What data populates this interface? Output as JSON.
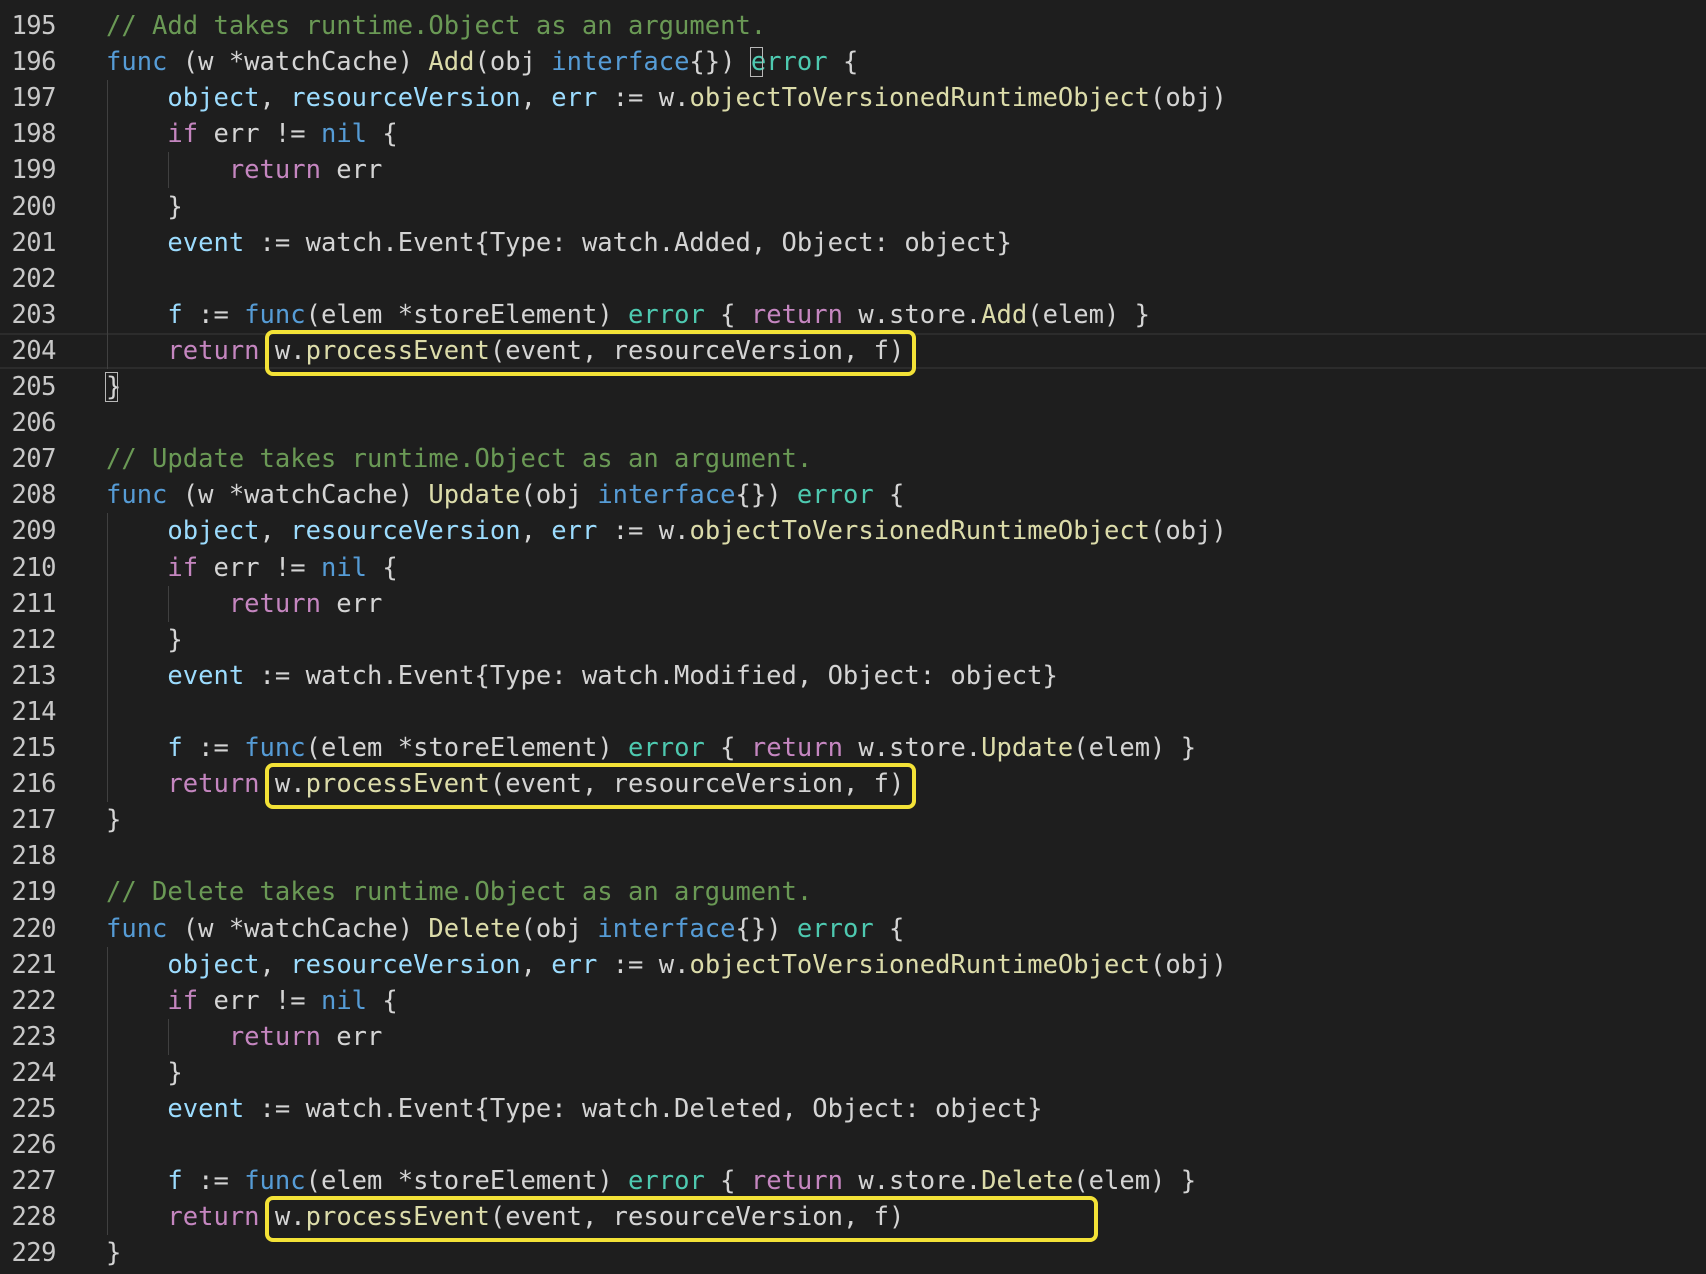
{
  "editor": {
    "theme_colors": {
      "background": "#1e1e1e",
      "keyword": "#569cd6",
      "control": "#c586c0",
      "type": "#4ec9b0",
      "function": "#dcdcaa",
      "variable": "#9cdcfe",
      "comment": "#6a9955",
      "plain": "#d4d4d4",
      "highlight_box": "#f3e237"
    },
    "lines": [
      {
        "n": "195",
        "tokens": [
          [
            "comment",
            "// Add takes runtime.Object as an argument."
          ]
        ]
      },
      {
        "n": "196",
        "tokens": [
          [
            "keyword",
            "func"
          ],
          [
            "plain",
            " (w *watchCache) "
          ],
          [
            "func",
            "Add"
          ],
          [
            "plain",
            "(obj "
          ],
          [
            "keyword",
            "interface"
          ],
          [
            "plain",
            "{}) "
          ],
          [
            "type",
            "error"
          ],
          [
            "plain",
            " {"
          ]
        ]
      },
      {
        "n": "197",
        "tokens": [
          [
            "plain",
            "    "
          ],
          [
            "var",
            "object"
          ],
          [
            "plain",
            ", "
          ],
          [
            "var",
            "resourceVersion"
          ],
          [
            "plain",
            ", "
          ],
          [
            "var",
            "err"
          ],
          [
            "plain",
            " := w."
          ],
          [
            "func",
            "objectToVersionedRuntimeObject"
          ],
          [
            "plain",
            "(obj)"
          ]
        ]
      },
      {
        "n": "198",
        "tokens": [
          [
            "plain",
            "    "
          ],
          [
            "control",
            "if"
          ],
          [
            "plain",
            " err != "
          ],
          [
            "keyword",
            "nil"
          ],
          [
            "plain",
            " {"
          ]
        ]
      },
      {
        "n": "199",
        "tokens": [
          [
            "plain",
            "        "
          ],
          [
            "control",
            "return"
          ],
          [
            "plain",
            " err"
          ]
        ]
      },
      {
        "n": "200",
        "tokens": [
          [
            "plain",
            "    }"
          ]
        ]
      },
      {
        "n": "201",
        "tokens": [
          [
            "plain",
            "    "
          ],
          [
            "var",
            "event"
          ],
          [
            "plain",
            " := watch.Event{Type: watch.Added, Object: object}"
          ]
        ]
      },
      {
        "n": "202",
        "tokens": []
      },
      {
        "n": "203",
        "tokens": [
          [
            "plain",
            "    "
          ],
          [
            "var",
            "f"
          ],
          [
            "plain",
            " := "
          ],
          [
            "keyword",
            "func"
          ],
          [
            "plain",
            "(elem *storeElement) "
          ],
          [
            "type",
            "error"
          ],
          [
            "plain",
            " { "
          ],
          [
            "control",
            "return"
          ],
          [
            "plain",
            " w.store."
          ],
          [
            "func",
            "Add"
          ],
          [
            "plain",
            "(elem) }"
          ]
        ]
      },
      {
        "n": "204",
        "tokens": [
          [
            "plain",
            "    "
          ],
          [
            "control",
            "return"
          ],
          [
            "plain",
            " w."
          ],
          [
            "func",
            "processEvent"
          ],
          [
            "plain",
            "(event, resourceVersion, f)"
          ]
        ]
      },
      {
        "n": "205",
        "tokens": [
          [
            "plain",
            "}"
          ]
        ]
      },
      {
        "n": "206",
        "tokens": []
      },
      {
        "n": "207",
        "tokens": [
          [
            "comment",
            "// Update takes runtime.Object as an argument."
          ]
        ]
      },
      {
        "n": "208",
        "tokens": [
          [
            "keyword",
            "func"
          ],
          [
            "plain",
            " (w *watchCache) "
          ],
          [
            "func",
            "Update"
          ],
          [
            "plain",
            "(obj "
          ],
          [
            "keyword",
            "interface"
          ],
          [
            "plain",
            "{}) "
          ],
          [
            "type",
            "error"
          ],
          [
            "plain",
            " {"
          ]
        ]
      },
      {
        "n": "209",
        "tokens": [
          [
            "plain",
            "    "
          ],
          [
            "var",
            "object"
          ],
          [
            "plain",
            ", "
          ],
          [
            "var",
            "resourceVersion"
          ],
          [
            "plain",
            ", "
          ],
          [
            "var",
            "err"
          ],
          [
            "plain",
            " := w."
          ],
          [
            "func",
            "objectToVersionedRuntimeObject"
          ],
          [
            "plain",
            "(obj)"
          ]
        ]
      },
      {
        "n": "210",
        "tokens": [
          [
            "plain",
            "    "
          ],
          [
            "control",
            "if"
          ],
          [
            "plain",
            " err != "
          ],
          [
            "keyword",
            "nil"
          ],
          [
            "plain",
            " {"
          ]
        ]
      },
      {
        "n": "211",
        "tokens": [
          [
            "plain",
            "        "
          ],
          [
            "control",
            "return"
          ],
          [
            "plain",
            " err"
          ]
        ]
      },
      {
        "n": "212",
        "tokens": [
          [
            "plain",
            "    }"
          ]
        ]
      },
      {
        "n": "213",
        "tokens": [
          [
            "plain",
            "    "
          ],
          [
            "var",
            "event"
          ],
          [
            "plain",
            " := watch.Event{Type: watch.Modified, Object: object}"
          ]
        ]
      },
      {
        "n": "214",
        "tokens": []
      },
      {
        "n": "215",
        "tokens": [
          [
            "plain",
            "    "
          ],
          [
            "var",
            "f"
          ],
          [
            "plain",
            " := "
          ],
          [
            "keyword",
            "func"
          ],
          [
            "plain",
            "(elem *storeElement) "
          ],
          [
            "type",
            "error"
          ],
          [
            "plain",
            " { "
          ],
          [
            "control",
            "return"
          ],
          [
            "plain",
            " w.store."
          ],
          [
            "func",
            "Update"
          ],
          [
            "plain",
            "(elem) }"
          ]
        ]
      },
      {
        "n": "216",
        "tokens": [
          [
            "plain",
            "    "
          ],
          [
            "control",
            "return"
          ],
          [
            "plain",
            " w."
          ],
          [
            "func",
            "processEvent"
          ],
          [
            "plain",
            "(event, resourceVersion, f)"
          ]
        ]
      },
      {
        "n": "217",
        "tokens": [
          [
            "plain",
            "}"
          ]
        ]
      },
      {
        "n": "218",
        "tokens": []
      },
      {
        "n": "219",
        "tokens": [
          [
            "comment",
            "// Delete takes runtime.Object as an argument."
          ]
        ]
      },
      {
        "n": "220",
        "tokens": [
          [
            "keyword",
            "func"
          ],
          [
            "plain",
            " (w *watchCache) "
          ],
          [
            "func",
            "Delete"
          ],
          [
            "plain",
            "(obj "
          ],
          [
            "keyword",
            "interface"
          ],
          [
            "plain",
            "{}) "
          ],
          [
            "type",
            "error"
          ],
          [
            "plain",
            " {"
          ]
        ]
      },
      {
        "n": "221",
        "tokens": [
          [
            "plain",
            "    "
          ],
          [
            "var",
            "object"
          ],
          [
            "plain",
            ", "
          ],
          [
            "var",
            "resourceVersion"
          ],
          [
            "plain",
            ", "
          ],
          [
            "var",
            "err"
          ],
          [
            "plain",
            " := w."
          ],
          [
            "func",
            "objectToVersionedRuntimeObject"
          ],
          [
            "plain",
            "(obj)"
          ]
        ]
      },
      {
        "n": "222",
        "tokens": [
          [
            "plain",
            "    "
          ],
          [
            "control",
            "if"
          ],
          [
            "plain",
            " err != "
          ],
          [
            "keyword",
            "nil"
          ],
          [
            "plain",
            " {"
          ]
        ]
      },
      {
        "n": "223",
        "tokens": [
          [
            "plain",
            "        "
          ],
          [
            "control",
            "return"
          ],
          [
            "plain",
            " err"
          ]
        ]
      },
      {
        "n": "224",
        "tokens": [
          [
            "plain",
            "    }"
          ]
        ]
      },
      {
        "n": "225",
        "tokens": [
          [
            "plain",
            "    "
          ],
          [
            "var",
            "event"
          ],
          [
            "plain",
            " := watch.Event{Type: watch.Deleted, Object: object}"
          ]
        ]
      },
      {
        "n": "226",
        "tokens": []
      },
      {
        "n": "227",
        "tokens": [
          [
            "plain",
            "    "
          ],
          [
            "var",
            "f"
          ],
          [
            "plain",
            " := "
          ],
          [
            "keyword",
            "func"
          ],
          [
            "plain",
            "(elem *storeElement) "
          ],
          [
            "type",
            "error"
          ],
          [
            "plain",
            " { "
          ],
          [
            "control",
            "return"
          ],
          [
            "plain",
            " w.store."
          ],
          [
            "func",
            "Delete"
          ],
          [
            "plain",
            "(elem) }"
          ]
        ]
      },
      {
        "n": "228",
        "tokens": [
          [
            "plain",
            "    "
          ],
          [
            "control",
            "return"
          ],
          [
            "plain",
            " w."
          ],
          [
            "func",
            "processEvent"
          ],
          [
            "plain",
            "(event, resourceVersion, f)"
          ]
        ]
      },
      {
        "n": "229",
        "tokens": [
          [
            "plain",
            "}"
          ]
        ]
      }
    ],
    "highlighted_lines": [
      "204",
      "216",
      "228"
    ],
    "current_line": "204"
  }
}
